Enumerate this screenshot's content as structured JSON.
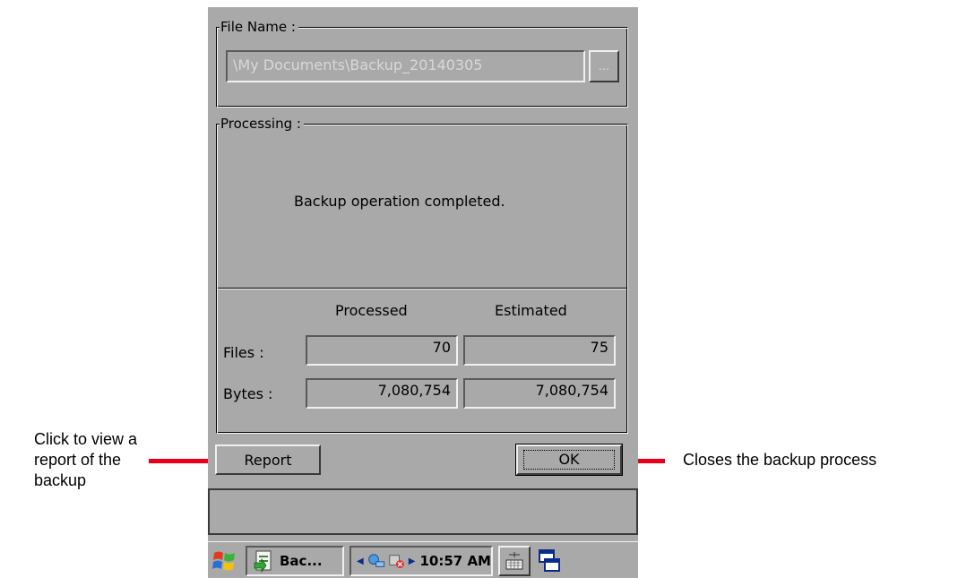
{
  "window": {
    "file_group_label": "File Name :",
    "file_path": "\\My Documents\\Backup_20140305",
    "browse_label": "...",
    "processing_group_label": "Processing :",
    "status_message": "Backup operation completed.",
    "columns": [
      "Processed",
      "Estimated"
    ],
    "rows": [
      {
        "label": "Files :",
        "processed": "70",
        "estimated": "75"
      },
      {
        "label": "Bytes :",
        "processed": "7,080,754",
        "estimated": "7,080,754"
      }
    ],
    "report_button": "Report",
    "ok_button": "OK"
  },
  "taskbar": {
    "task_label": "Bac...",
    "clock": "10:57 AM"
  },
  "annotations": {
    "left": [
      "Click to view a",
      "report of the",
      "backup"
    ],
    "right": "Closes the backup process"
  },
  "colors": {
    "surface": "#a9a9a9",
    "callout_line": "#e8001c"
  }
}
